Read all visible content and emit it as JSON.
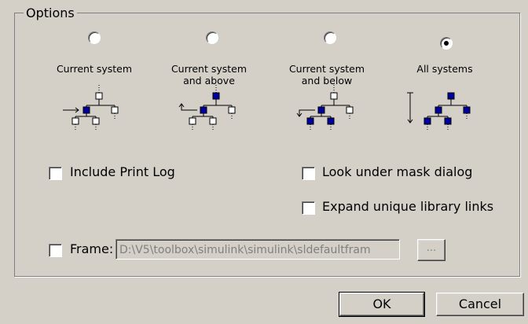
{
  "group": {
    "title": "Options"
  },
  "radios": [
    {
      "label": "Current system",
      "selected": false
    },
    {
      "label": "Current system\nand above",
      "selected": false
    },
    {
      "label": "Current system\nand below",
      "selected": false
    },
    {
      "label": "All systems",
      "selected": true
    }
  ],
  "checkboxes": {
    "include_print_log": {
      "label": "Include Print Log",
      "checked": false
    },
    "look_under_mask": {
      "label": "Look under mask dialog",
      "checked": false
    },
    "expand_library_links": {
      "label": "Expand unique library links",
      "checked": false
    },
    "frame": {
      "label": "Frame:",
      "checked": false
    }
  },
  "frame_path": "D:\\V5\\toolbox\\simulink\\simulink\\sldefaultfram",
  "buttons": {
    "browse": "...",
    "ok": "OK",
    "cancel": "Cancel"
  },
  "colors": {
    "selected_node": "#0000a0",
    "unselected_node": "#ffffff",
    "dialog_bg": "#d4d0c8"
  }
}
